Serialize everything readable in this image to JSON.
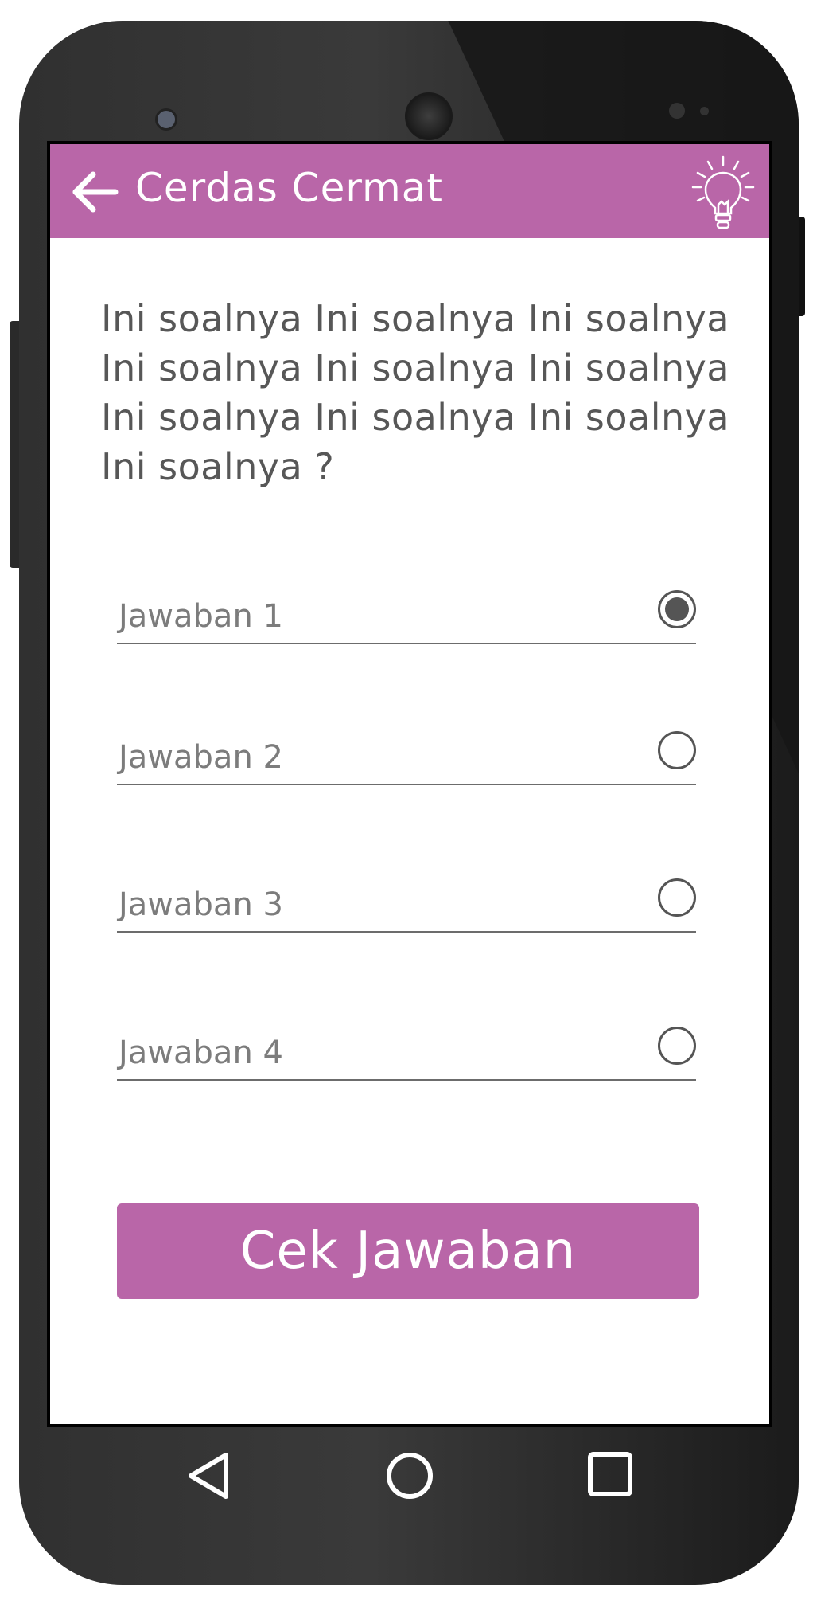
{
  "app_bar": {
    "title": "Cerdas Cermat",
    "background_color": "#b966a8",
    "back_icon": "arrow-left-icon",
    "hint_icon": "lightbulb-icon"
  },
  "question": {
    "text": "Ini soalnya Ini soalnya Ini soalnya Ini soalnya Ini soalnya Ini soalnya Ini soalnya Ini soalnya Ini soalnya Ini soalnya ?"
  },
  "answers": [
    {
      "label": "Jawaban 1",
      "selected": true
    },
    {
      "label": "Jawaban 2",
      "selected": false
    },
    {
      "label": "Jawaban 3",
      "selected": false
    },
    {
      "label": "Jawaban 4",
      "selected": false
    }
  ],
  "submit_button": {
    "label": "Cek Jawaban",
    "color": "#b966a8"
  },
  "navigation_bar": {
    "back_icon": "nav-back-icon",
    "home_icon": "nav-home-icon",
    "recents_icon": "nav-recents-icon"
  }
}
